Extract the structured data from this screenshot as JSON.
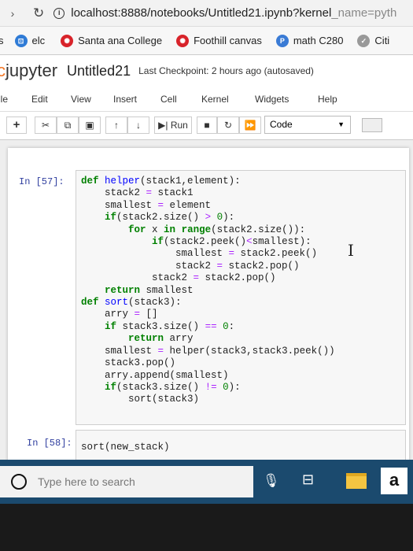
{
  "browser": {
    "url_main": "localhost:8888/notebooks/Untitled21.ipynb?kernel",
    "url_faded": "_name=pyth"
  },
  "bookmarks": [
    {
      "label": "s",
      "icon": "none"
    },
    {
      "label": "elc",
      "icon": "bookmark-icon"
    },
    {
      "label": "Santa ana College",
      "icon": "bookmark-icon"
    },
    {
      "label": "Foothill canvas",
      "icon": "bookmark-icon"
    },
    {
      "label": "math C280",
      "icon": "bookmark-icon"
    },
    {
      "label": "Citi",
      "icon": "bookmark-icon"
    }
  ],
  "jupyter": {
    "logo_text": "jupyter",
    "notebook_name": "Untitled21",
    "checkpoint": "Last Checkpoint: 2 hours ago",
    "autosave": "(autosaved)"
  },
  "menu": [
    "ile",
    "Edit",
    "View",
    "Insert",
    "Cell",
    "Kernel",
    "Widgets",
    "Help"
  ],
  "toolbar": {
    "run_label": "Run",
    "cell_type": "Code"
  },
  "cells": [
    {
      "prompt": "In [57]:",
      "code": "def helper(stack1,element):\n    stack2 = stack1\n    smallest = element\n    if(stack2.size() > 0):\n        for x in range(stack2.size()):\n            if(stack2.peek()<smallest):\n                smallest = stack2.peek()\n                stack2 = stack2.pop()\n            stack2 = stack2.pop()\n    return smallest\ndef sort(stack3):\n    arry = []\n    if stack3.size() == 0:\n        return arry\n    smallest = helper(stack3,stack3.peek())\n    stack3.pop()\n    arry.append(smallest)\n    if(stack3.size() != 0):\n        sort(stack3)"
    },
    {
      "prompt": "In [58]:",
      "code": "sort(new_stack)"
    }
  ],
  "taskbar": {
    "search_placeholder": "Type here to search",
    "pinned_app_letter": "a"
  }
}
